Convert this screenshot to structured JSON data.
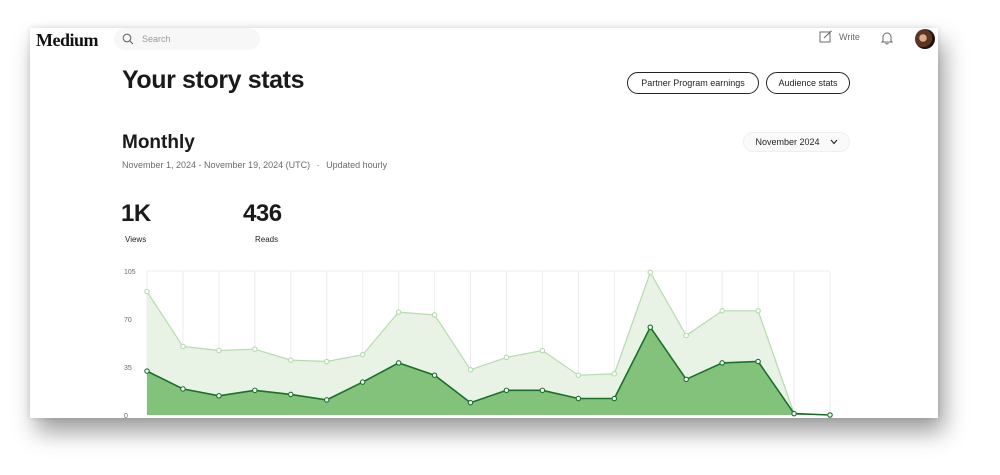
{
  "header": {
    "logo": "Medium",
    "search_placeholder": "Search",
    "write_label": "Write",
    "icons": {
      "search": "search-icon",
      "write": "pencil-square-icon",
      "notifications": "bell-icon"
    }
  },
  "page": {
    "title": "Your story stats",
    "buttons": {
      "partner_program": "Partner Program earnings",
      "audience_stats": "Audience stats"
    }
  },
  "monthly": {
    "title": "Monthly",
    "date_range": "November 1, 2024 - November 19, 2024 (UTC)",
    "separator": "·",
    "update_note": "Updated hourly",
    "selected_month": "November 2024"
  },
  "stats": {
    "views_value": "1K",
    "views_label": "Views",
    "reads_value": "436",
    "reads_label": "Reads"
  },
  "colors": {
    "views_fill": "#e8f3e6",
    "views_line": "#b5dbae",
    "reads_fill": "#83c27a",
    "reads_line": "#1a6f2a",
    "accent_text": "#242424"
  },
  "chart_data": {
    "type": "area",
    "x": [
      1,
      2,
      3,
      4,
      5,
      6,
      7,
      8,
      9,
      10,
      11,
      12,
      13,
      14,
      15,
      16,
      17,
      18,
      19,
      20
    ],
    "y_ticks": [
      "0",
      "35",
      "70",
      "105"
    ],
    "ylim": [
      0,
      105
    ],
    "grid": "vertical",
    "series": [
      {
        "values": [
          90,
          50,
          47,
          48,
          40,
          39,
          44,
          75,
          73,
          33,
          42,
          47,
          29,
          30,
          104,
          58,
          76,
          76,
          1,
          0
        ]
      },
      {
        "values": [
          32,
          19,
          14,
          18,
          15,
          11,
          24,
          38,
          29,
          9,
          18,
          18,
          12,
          12,
          64,
          26,
          38,
          39,
          1,
          0
        ]
      }
    ]
  }
}
